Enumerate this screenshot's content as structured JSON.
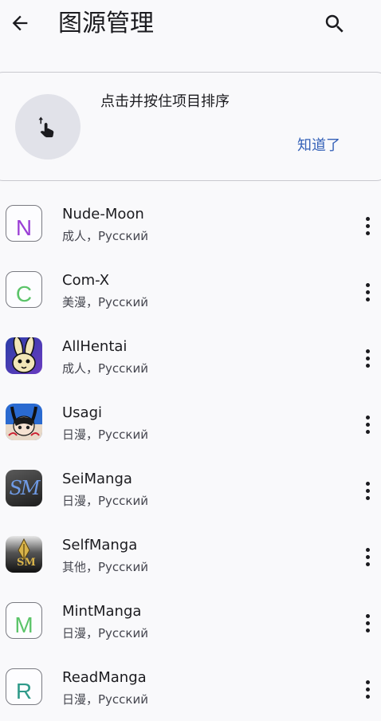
{
  "header": {
    "title": "图源管理",
    "back_icon": "arrow-back-icon",
    "search_icon": "search-icon"
  },
  "hint": {
    "text": "点击并按住项目排序",
    "dismiss_label": "知道了",
    "icon": "touch-drag-icon"
  },
  "sources": [
    {
      "name": "Nude-Moon",
      "sub": "成人，Русский",
      "icon_letter": "N",
      "icon_color": "#9b3fd6"
    },
    {
      "name": "Com-X",
      "sub": "美漫，Русский",
      "icon_letter": "C",
      "icon_color": "#5cc46a"
    },
    {
      "name": "AllHentai",
      "sub": "成人，Русский",
      "icon_letter": "",
      "icon_color": "#3a4fb0"
    },
    {
      "name": "Usagi",
      "sub": "日漫，Русский",
      "icon_letter": "",
      "icon_color": "#2a6ad0"
    },
    {
      "name": "SeiManga",
      "sub": "日漫，Русский",
      "icon_letter": "SM",
      "icon_color": "#5a86d6"
    },
    {
      "name": "SelfManga",
      "sub": "其他，Русский",
      "icon_letter": "SM",
      "icon_color": "#c9a13a"
    },
    {
      "name": "MintManga",
      "sub": "日漫，Русский",
      "icon_letter": "M",
      "icon_color": "#5cc46a"
    },
    {
      "name": "ReadManga",
      "sub": "日漫，Русский",
      "icon_letter": "R",
      "icon_color": "#2f9a8a"
    }
  ]
}
